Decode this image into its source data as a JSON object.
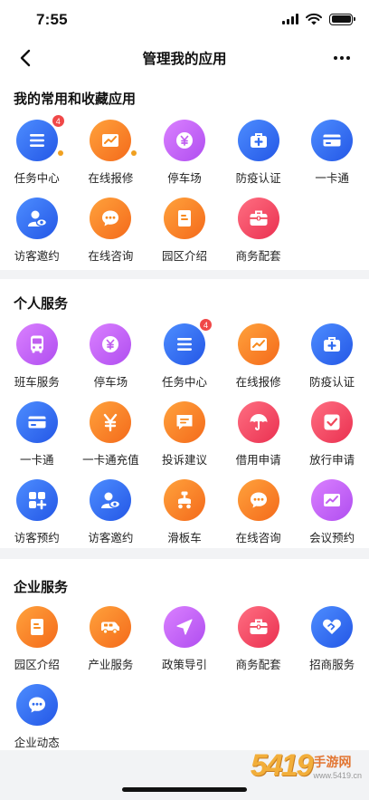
{
  "status_bar": {
    "time": "7:55"
  },
  "nav": {
    "title": "管理我的应用"
  },
  "colors": {
    "blue": "#2f6bf0",
    "orange": "#f78a1e",
    "purple": "#c15ff0",
    "red": "#f0465a",
    "badge": "#f04848",
    "dot": "#f0a020"
  },
  "sections": {
    "favorites": {
      "title": "我的常用和收藏应用",
      "items": [
        {
          "label": "任务中心",
          "icon": "list-icon",
          "color": "blue",
          "badge": "4",
          "dot": true
        },
        {
          "label": "在线报修",
          "icon": "chart-icon",
          "color": "orange",
          "dot": true
        },
        {
          "label": "停车场",
          "icon": "yen-coin-icon",
          "color": "purple"
        },
        {
          "label": "防疫认证",
          "icon": "medkit-icon",
          "color": "blue"
        },
        {
          "label": "一卡通",
          "icon": "card-icon",
          "color": "blue"
        },
        {
          "label": "访客邀约",
          "icon": "visitor-icon",
          "color": "blue"
        },
        {
          "label": "在线咨询",
          "icon": "chat-icon",
          "color": "orange"
        },
        {
          "label": "园区介绍",
          "icon": "document-icon",
          "color": "orange"
        },
        {
          "label": "商务配套",
          "icon": "briefcase-icon",
          "color": "red"
        }
      ]
    },
    "personal": {
      "title": "个人服务",
      "items": [
        {
          "label": "班车服务",
          "icon": "bus-icon",
          "color": "purple"
        },
        {
          "label": "停车场",
          "icon": "yen-coin-icon",
          "color": "purple"
        },
        {
          "label": "任务中心",
          "icon": "list-icon",
          "color": "blue",
          "badge": "4"
        },
        {
          "label": "在线报修",
          "icon": "chart-icon",
          "color": "orange"
        },
        {
          "label": "防疫认证",
          "icon": "medkit-icon",
          "color": "blue"
        },
        {
          "label": "一卡通",
          "icon": "card-icon",
          "color": "blue"
        },
        {
          "label": "一卡通充值",
          "icon": "yen-icon",
          "color": "orange"
        },
        {
          "label": "投诉建议",
          "icon": "comment-icon",
          "color": "orange"
        },
        {
          "label": "借用申请",
          "icon": "umbrella-icon",
          "color": "red"
        },
        {
          "label": "放行申请",
          "icon": "check-square-icon",
          "color": "red"
        },
        {
          "label": "访客预约",
          "icon": "apps-icon",
          "color": "blue"
        },
        {
          "label": "访客邀约",
          "icon": "visitor-icon",
          "color": "blue"
        },
        {
          "label": "滑板车",
          "icon": "scooter-icon",
          "color": "orange"
        },
        {
          "label": "在线咨询",
          "icon": "chat-icon",
          "color": "orange"
        },
        {
          "label": "会议预约",
          "icon": "chart-icon",
          "color": "purple"
        }
      ]
    },
    "enterprise": {
      "title": "企业服务",
      "items": [
        {
          "label": "园区介绍",
          "icon": "document-icon",
          "color": "orange"
        },
        {
          "label": "产业服务",
          "icon": "van-icon",
          "color": "orange"
        },
        {
          "label": "政策导引",
          "icon": "navigation-icon",
          "color": "purple"
        },
        {
          "label": "商务配套",
          "icon": "briefcase-icon",
          "color": "red"
        },
        {
          "label": "招商服务",
          "icon": "handshake-icon",
          "color": "blue"
        },
        {
          "label": "企业动态",
          "icon": "chat-icon",
          "color": "blue"
        }
      ]
    }
  },
  "watermark": {
    "digits": "5419",
    "brand": "手游网",
    "domain": "www.5419.cn"
  }
}
